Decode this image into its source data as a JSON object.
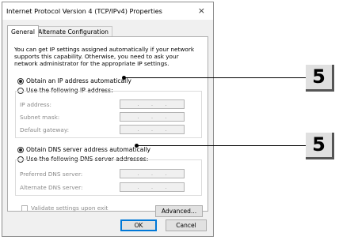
{
  "window": {
    "title": "Internet Protocol Version 4 (TCP/IPv4) Properties",
    "close_symbol": "×"
  },
  "tabs": [
    {
      "label": "General"
    },
    {
      "label": "Alternate Configuration"
    }
  ],
  "description": "You can get IP settings assigned automatically if your network supports this capability. Otherwise, you need to ask your network administrator for the appropriate IP settings.",
  "ip": {
    "auto_option": "Obtain an IP address automatically",
    "manual_option": "Use the following IP address:",
    "selected": "auto",
    "fields": [
      {
        "label": "IP address:"
      },
      {
        "label": "Subnet mask:"
      },
      {
        "label": "Default gateway:"
      }
    ]
  },
  "dns": {
    "auto_option": "Obtain DNS server address automatically",
    "manual_option": "Use the following DNS server addresses:",
    "selected": "auto",
    "fields": [
      {
        "label": "Preferred DNS server:"
      },
      {
        "label": "Alternate DNS server:"
      }
    ]
  },
  "ip_dots": ".",
  "validate_label": "Validate settings upon exit",
  "validate_checked": false,
  "buttons": {
    "advanced": "Advanced...",
    "ok": "OK",
    "cancel": "Cancel"
  },
  "callouts": [
    {
      "label": "5"
    },
    {
      "label": "5"
    }
  ]
}
